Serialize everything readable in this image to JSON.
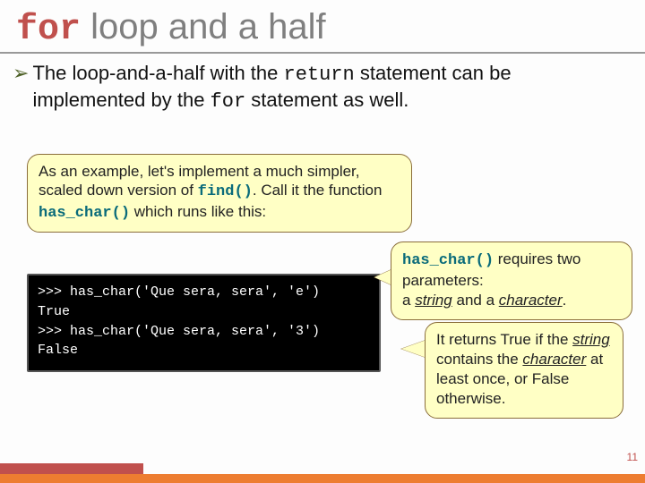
{
  "title": {
    "keyword": "for",
    "rest": " loop and a half"
  },
  "bullet": {
    "pre": "The loop-and-a-half with the ",
    "kw1": "return",
    "mid": " statement can be implemented by the ",
    "kw2": "for",
    "post": " statement as well."
  },
  "callout1": {
    "l1": "As an example, let's implement a much simpler, scaled down version of ",
    "fn1": "find()",
    "l2": ". Call it the function ",
    "fn2": "has_char()",
    "l3": " which runs like this:"
  },
  "code": {
    "line1": ">>> has_char('Que sera, sera', 'e')",
    "line2": "True",
    "line3": ">>> has_char('Que sera, sera', '3')",
    "line4": "False"
  },
  "callout2": {
    "fn": "has_char()",
    "t1": " requires two parameters:",
    "t2a": "a ",
    "u1": "string",
    "t2b": " and a ",
    "u2": "character",
    "t2c": "."
  },
  "callout3": {
    "t1": "It returns True if the ",
    "u1": "string",
    "t2": " contains the ",
    "u2": "character",
    "t3": " at least once, or False otherwise."
  },
  "slidenum": "11"
}
